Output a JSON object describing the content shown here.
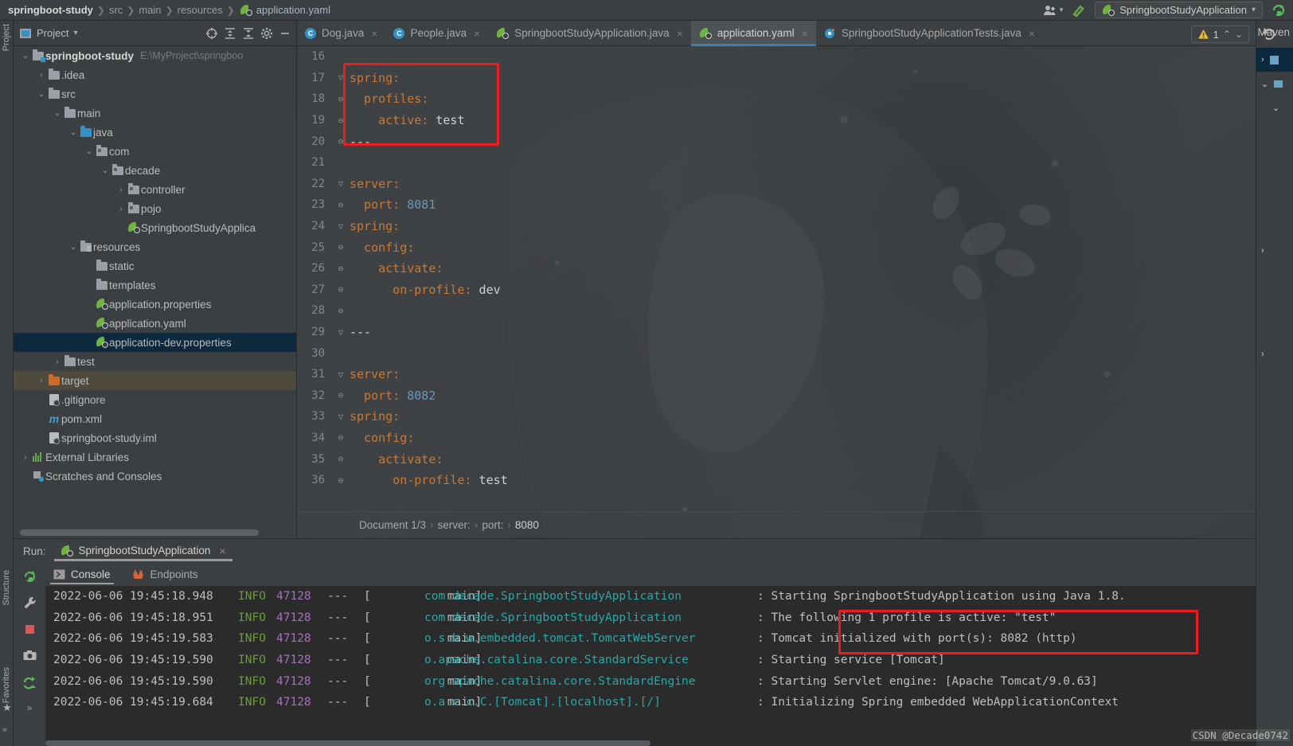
{
  "breadcrumb": {
    "items": [
      "springboot-study",
      "src",
      "main",
      "resources",
      "application.yaml"
    ],
    "separator": "❯"
  },
  "topbar": {
    "run_config": "SpringbootStudyApplication",
    "run_config_chevron": "▾",
    "account_icon": "account-icon",
    "build_icon": "build-hammer-icon",
    "rerun_icon": "rerun-icon"
  },
  "left_strip": {
    "project_label": "Project",
    "structure_label": "Structure",
    "favorites_label": "Favorites"
  },
  "project_panel": {
    "title": "Project",
    "chevron": "▾",
    "icons": [
      "locate-icon",
      "expand-all-icon",
      "collapse-all-icon",
      "gear-icon",
      "minimize-icon"
    ],
    "tree": [
      {
        "depth": 0,
        "arrow": "⌄",
        "icon": "module-folder",
        "label": "springboot-study",
        "bold": true,
        "path": "E:\\MyProject\\springboo",
        "state": "normal"
      },
      {
        "depth": 1,
        "arrow": "›",
        "icon": "folder",
        "label": ".idea",
        "state": "normal"
      },
      {
        "depth": 1,
        "arrow": "⌄",
        "icon": "folder",
        "label": "src",
        "state": "normal"
      },
      {
        "depth": 2,
        "arrow": "⌄",
        "icon": "folder",
        "label": "main",
        "state": "normal"
      },
      {
        "depth": 3,
        "arrow": "⌄",
        "icon": "source-folder",
        "label": "java",
        "state": "normal"
      },
      {
        "depth": 4,
        "arrow": "⌄",
        "icon": "package",
        "label": "com",
        "state": "normal"
      },
      {
        "depth": 5,
        "arrow": "⌄",
        "icon": "package",
        "label": "decade",
        "state": "normal"
      },
      {
        "depth": 6,
        "arrow": "›",
        "icon": "package",
        "label": "controller",
        "state": "normal"
      },
      {
        "depth": 6,
        "arrow": "›",
        "icon": "package",
        "label": "pojo",
        "state": "normal"
      },
      {
        "depth": 6,
        "arrow": "",
        "icon": "spring-class",
        "label": "SpringbootStudyApplica",
        "state": "normal"
      },
      {
        "depth": 3,
        "arrow": "⌄",
        "icon": "resource-folder",
        "label": "resources",
        "state": "normal"
      },
      {
        "depth": 4,
        "arrow": "",
        "icon": "folder",
        "label": "static",
        "state": "normal"
      },
      {
        "depth": 4,
        "arrow": "",
        "icon": "folder",
        "label": "templates",
        "state": "normal"
      },
      {
        "depth": 4,
        "arrow": "",
        "icon": "spring-config",
        "label": "application.properties",
        "state": "normal"
      },
      {
        "depth": 4,
        "arrow": "",
        "icon": "spring-config",
        "label": "application.yaml",
        "state": "normal"
      },
      {
        "depth": 4,
        "arrow": "",
        "icon": "spring-config",
        "label": "application-dev.properties",
        "state": "selected"
      },
      {
        "depth": 2,
        "arrow": "›",
        "icon": "folder",
        "label": "test",
        "state": "normal"
      },
      {
        "depth": 1,
        "arrow": "›",
        "icon": "target-folder",
        "label": "target",
        "state": "target"
      },
      {
        "depth": 1,
        "arrow": "",
        "icon": "file",
        "label": ".gitignore",
        "state": "normal"
      },
      {
        "depth": 1,
        "arrow": "",
        "icon": "maven-file",
        "label": "pom.xml",
        "state": "normal"
      },
      {
        "depth": 1,
        "arrow": "",
        "icon": "iml-file",
        "label": "springboot-study.iml",
        "state": "normal"
      },
      {
        "depth": 0,
        "arrow": "›",
        "icon": "libraries",
        "label": "External Libraries",
        "state": "normal"
      },
      {
        "depth": 0,
        "arrow": "",
        "icon": "scratches",
        "label": "Scratches and Consoles",
        "state": "normal"
      }
    ]
  },
  "editor": {
    "tabs": [
      {
        "label": "Dog.java",
        "icon": "java-class-icon",
        "active": false,
        "close": "×"
      },
      {
        "label": "People.java",
        "icon": "java-class-icon",
        "active": false,
        "close": "×"
      },
      {
        "label": "SpringbootStudyApplication.java",
        "icon": "spring-class-icon",
        "active": false,
        "close": "×"
      },
      {
        "label": "application.yaml",
        "icon": "spring-config-icon",
        "active": true,
        "close": "×"
      },
      {
        "label": "SpringbootStudyApplicationTests.java",
        "icon": "junit-class-icon",
        "active": false,
        "close": "×"
      }
    ],
    "warning_count": "1",
    "warning_icon": "warning-triangle-icon",
    "nav_up": "⌃",
    "nav_down": "⌄",
    "breadcrumb": {
      "document": "Document 1/3",
      "items": [
        "server:",
        "port:",
        "8080"
      ],
      "separator": "›"
    },
    "lines": [
      {
        "num": "16",
        "fold": "",
        "tokens": []
      },
      {
        "num": "17",
        "fold": "▽",
        "tokens": [
          {
            "t": "spring:",
            "c": "k"
          }
        ]
      },
      {
        "num": "18",
        "fold": "⊖",
        "tokens": [
          {
            "t": "  profiles:",
            "c": "k"
          }
        ]
      },
      {
        "num": "19",
        "fold": "⊖",
        "tokens": [
          {
            "t": "    active:",
            "c": "k"
          },
          {
            "t": " test",
            "c": "v"
          }
        ]
      },
      {
        "num": "20",
        "fold": "⊖",
        "tokens": [
          {
            "t": "---",
            "c": "v"
          }
        ]
      },
      {
        "num": "21",
        "fold": "",
        "tokens": []
      },
      {
        "num": "22",
        "fold": "▽",
        "tokens": [
          {
            "t": "server:",
            "c": "k"
          }
        ]
      },
      {
        "num": "23",
        "fold": "⊖",
        "tokens": [
          {
            "t": "  port:",
            "c": "k"
          },
          {
            "t": " 8081",
            "c": "n"
          }
        ]
      },
      {
        "num": "24",
        "fold": "▽",
        "tokens": [
          {
            "t": "spring:",
            "c": "k"
          }
        ]
      },
      {
        "num": "25",
        "fold": "⊖",
        "tokens": [
          {
            "t": "  config:",
            "c": "k"
          }
        ]
      },
      {
        "num": "26",
        "fold": "⊖",
        "tokens": [
          {
            "t": "    activate:",
            "c": "k"
          }
        ]
      },
      {
        "num": "27",
        "fold": "⊖",
        "tokens": [
          {
            "t": "      on-profile:",
            "c": "k"
          },
          {
            "t": " dev",
            "c": "v"
          }
        ]
      },
      {
        "num": "28",
        "fold": "⊖",
        "tokens": []
      },
      {
        "num": "29",
        "fold": "▽",
        "tokens": [
          {
            "t": "---",
            "c": "v"
          }
        ]
      },
      {
        "num": "30",
        "fold": "",
        "tokens": []
      },
      {
        "num": "31",
        "fold": "▽",
        "tokens": [
          {
            "t": "server:",
            "c": "k"
          }
        ]
      },
      {
        "num": "32",
        "fold": "⊖",
        "tokens": [
          {
            "t": "  port:",
            "c": "k"
          },
          {
            "t": " 8082",
            "c": "n"
          }
        ]
      },
      {
        "num": "33",
        "fold": "▽",
        "tokens": [
          {
            "t": "spring:",
            "c": "k"
          }
        ]
      },
      {
        "num": "34",
        "fold": "⊖",
        "tokens": [
          {
            "t": "  config:",
            "c": "k"
          }
        ]
      },
      {
        "num": "35",
        "fold": "⊖",
        "tokens": [
          {
            "t": "    activate:",
            "c": "k"
          }
        ]
      },
      {
        "num": "36",
        "fold": "⊖",
        "tokens": [
          {
            "t": "      on-profile:",
            "c": "k"
          },
          {
            "t": " test",
            "c": "v"
          }
        ]
      }
    ]
  },
  "run_panel": {
    "run_label": "Run:",
    "config_name": "SpringbootStudyApplication",
    "close": "×",
    "toolbar_left": [
      "rerun-icon",
      "settings-wrench-icon",
      "stop-icon",
      "screenshot-camera-icon",
      "thread-dump-icon",
      "more-icon"
    ],
    "toolbar_right": [
      "show-console-icon",
      "scroll-up-icon",
      "scroll-down-icon",
      "soft-wrap-icon",
      "scroll-to-end-icon",
      "more-icon"
    ],
    "tabs": [
      {
        "label": "Console",
        "icon": "console-icon",
        "active": true
      },
      {
        "label": "Endpoints",
        "icon": "endpoints-icon",
        "active": false
      }
    ],
    "log": [
      {
        "ts": "2022-06-06 19:45:18.948",
        "level": "INFO",
        "pid": "47128",
        "dash": "---",
        "thread": "[           main]",
        "cls": "com.decade.SpringbootStudyApplication",
        "msg": ": Starting SpringbootStudyApplication using Java 1.8."
      },
      {
        "ts": "2022-06-06 19:45:18.951",
        "level": "INFO",
        "pid": "47128",
        "dash": "---",
        "thread": "[           main]",
        "cls": "com.decade.SpringbootStudyApplication",
        "msg": ": The following 1 profile is active: \"test\""
      },
      {
        "ts": "2022-06-06 19:45:19.583",
        "level": "INFO",
        "pid": "47128",
        "dash": "---",
        "thread": "[           main]",
        "cls": "o.s.b.w.embedded.tomcat.TomcatWebServer",
        "msg": ": Tomcat initialized with port(s): 8082 (http)"
      },
      {
        "ts": "2022-06-06 19:45:19.590",
        "level": "INFO",
        "pid": "47128",
        "dash": "---",
        "thread": "[           main]",
        "cls": "o.apache.catalina.core.StandardService",
        "msg": ": Starting service [Tomcat]"
      },
      {
        "ts": "2022-06-06 19:45:19.590",
        "level": "INFO",
        "pid": "47128",
        "dash": "---",
        "thread": "[           main]",
        "cls": "org.apache.catalina.core.StandardEngine",
        "msg": ": Starting Servlet engine: [Apache Tomcat/9.0.63]"
      },
      {
        "ts": "2022-06-06 19:45:19.684",
        "level": "INFO",
        "pid": "47128",
        "dash": "---",
        "thread": "[           main]",
        "cls": "o.a.c.c.C.[Tomcat].[localhost].[/]",
        "msg": ": Initializing Spring embedded WebApplicationContext"
      }
    ]
  },
  "right_strip": {
    "maven_label": "Maven",
    "icons": [
      "refresh-icon",
      "chevron-right-icon",
      "chevron-down-icon",
      "chevron-right-icon-2"
    ]
  },
  "watermark": "CSDN @Decade0742",
  "colors": {
    "accent_blue": "#3c7fb1",
    "annotation_red": "#ee1c1c",
    "yaml_key": "#cc7832",
    "number": "#6897bb",
    "log_class": "#29a8a8",
    "log_level": "#6a9c3b",
    "log_pid": "#a771bf",
    "spring_green": "#6db33f",
    "selection": "#0d293e"
  }
}
